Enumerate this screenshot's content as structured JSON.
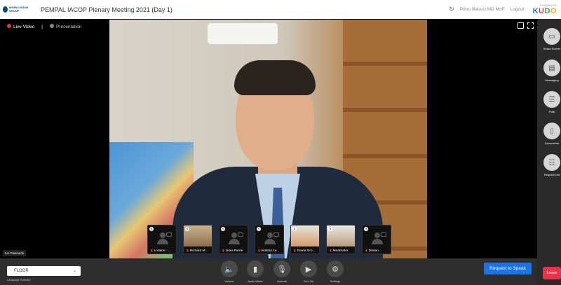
{
  "header": {
    "logo_text": "WORLD BANK GROUP",
    "title": "PEMPAL IACOP Plenary Meeting 2021 (Day 1)",
    "user_name": "Petru Babuci MD MoF",
    "logout_label": "Logout",
    "powered_by": "POWERED BY",
    "kudo": "KUDO"
  },
  "modes": {
    "live_video": "Live Video",
    "presentation": "Presentation"
  },
  "speaker_caption": "Ion Pasieuchi",
  "participants": [
    {
      "name": "Loraine - ...",
      "badge": "S"
    },
    {
      "name": "Richard M...",
      "badge": "S"
    },
    {
      "name": "Jean-Pierre",
      "badge": "S"
    },
    {
      "name": "kristina za...",
      "badge": "S"
    },
    {
      "name": "Diana Gro...",
      "badge": "S"
    },
    {
      "name": "Moderator",
      "badge": "S"
    },
    {
      "name": "Darian",
      "badge": "S"
    }
  ],
  "sidebar": {
    "share_screen": "Share Screen",
    "messaging": "Messaging",
    "polls": "Polls",
    "documents": "Documents",
    "request_list": "Request List"
  },
  "language": {
    "selected": "FLOOR",
    "label": "Language Selector"
  },
  "controls": {
    "volume": "Volume",
    "audio_meter": "Audio Meter",
    "unmute": "Unmute",
    "turn_on": "Turn On",
    "settings": "Settings"
  },
  "request_to_speak": "Request to Speak",
  "leave": "Leave",
  "colors": {
    "accent": "#1a73e8",
    "leave": "#e8334a",
    "live": "#e53935"
  }
}
